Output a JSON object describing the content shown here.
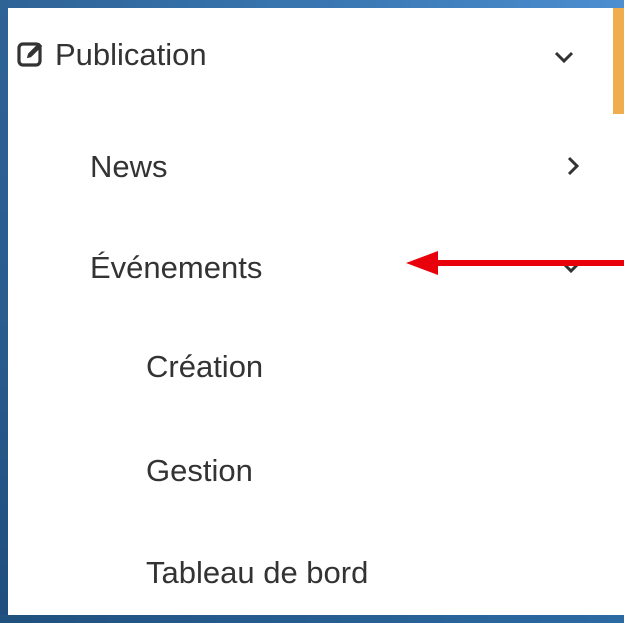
{
  "menu": {
    "publication": {
      "label": "Publication",
      "icon": "edit-icon",
      "state": "expanded"
    },
    "items": [
      {
        "label": "News",
        "icon": "chevron-right-icon"
      },
      {
        "label": "Événements",
        "icon": "chevron-down-icon"
      }
    ],
    "subitems": [
      {
        "label": "Création"
      },
      {
        "label": "Gestion"
      },
      {
        "label": "Tableau de bord"
      }
    ]
  },
  "colors": {
    "frame": "#2e6396",
    "accent": "#f0ad4e",
    "text": "#333333",
    "annotation_arrow": "#e8000b"
  }
}
